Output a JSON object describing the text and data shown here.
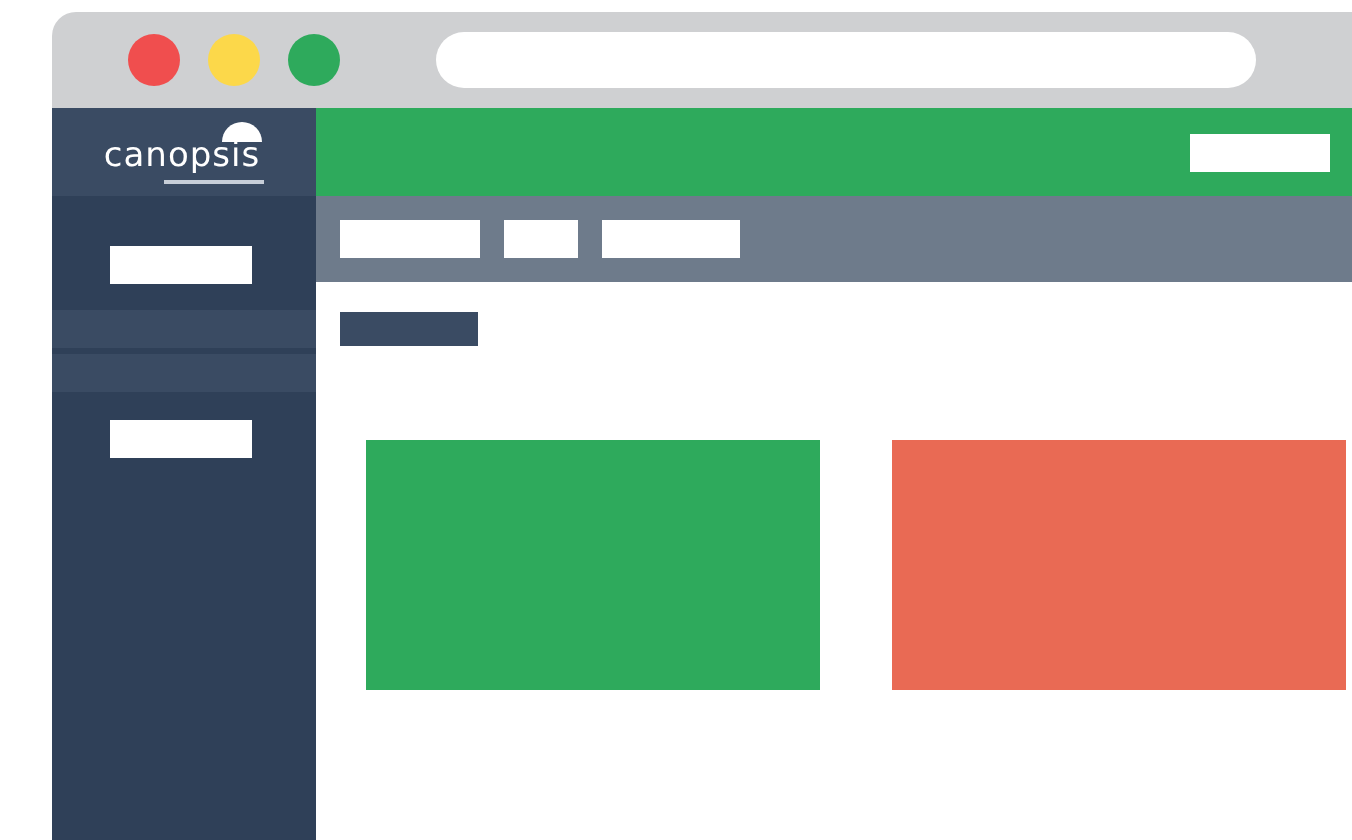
{
  "logo": {
    "text": "canopsis"
  },
  "tiles": [
    {
      "color": "#2eaa5c"
    },
    {
      "color": "#e96a54"
    }
  ]
}
